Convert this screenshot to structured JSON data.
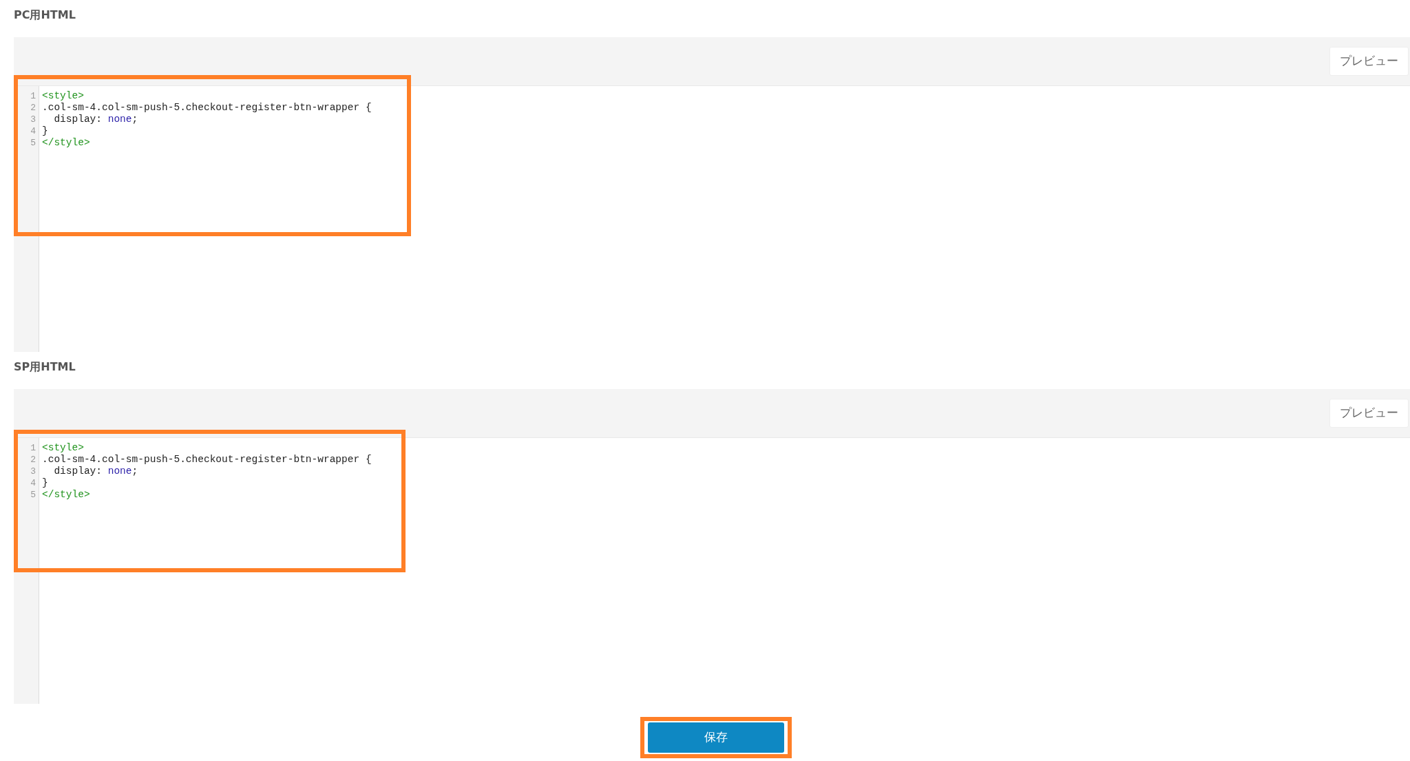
{
  "editors": [
    {
      "title": "PC用HTML",
      "preview_button": "プレビュー",
      "highlighted": true,
      "lines": [
        {
          "number": "1",
          "tokens": [
            {
              "kind": "tag",
              "text": "<style>"
            }
          ]
        },
        {
          "number": "2",
          "tokens": [
            {
              "kind": "plain",
              "text": ".col-sm-4.col-sm-push-5.checkout-register-btn-wrapper {"
            }
          ]
        },
        {
          "number": "3",
          "tokens": [
            {
              "kind": "plain",
              "text": "  display: "
            },
            {
              "kind": "value",
              "text": "none"
            },
            {
              "kind": "plain",
              "text": ";"
            }
          ]
        },
        {
          "number": "4",
          "tokens": [
            {
              "kind": "plain",
              "text": "}"
            }
          ]
        },
        {
          "number": "5",
          "tokens": [
            {
              "kind": "tag",
              "text": "</style>"
            }
          ]
        }
      ]
    },
    {
      "title": "SP用HTML",
      "preview_button": "プレビュー",
      "highlighted": true,
      "lines": [
        {
          "number": "1",
          "tokens": [
            {
              "kind": "tag",
              "text": "<style>"
            }
          ]
        },
        {
          "number": "2",
          "tokens": [
            {
              "kind": "plain",
              "text": ".col-sm-4.col-sm-push-5.checkout-register-btn-wrapper {"
            }
          ]
        },
        {
          "number": "3",
          "tokens": [
            {
              "kind": "plain",
              "text": "  display: "
            },
            {
              "kind": "value",
              "text": "none"
            },
            {
              "kind": "plain",
              "text": ";"
            }
          ]
        },
        {
          "number": "4",
          "tokens": [
            {
              "kind": "plain",
              "text": "}"
            }
          ]
        },
        {
          "number": "5",
          "tokens": [
            {
              "kind": "tag",
              "text": "</style>"
            }
          ]
        }
      ]
    }
  ],
  "save_button": {
    "label": "保存",
    "highlighted": true
  }
}
